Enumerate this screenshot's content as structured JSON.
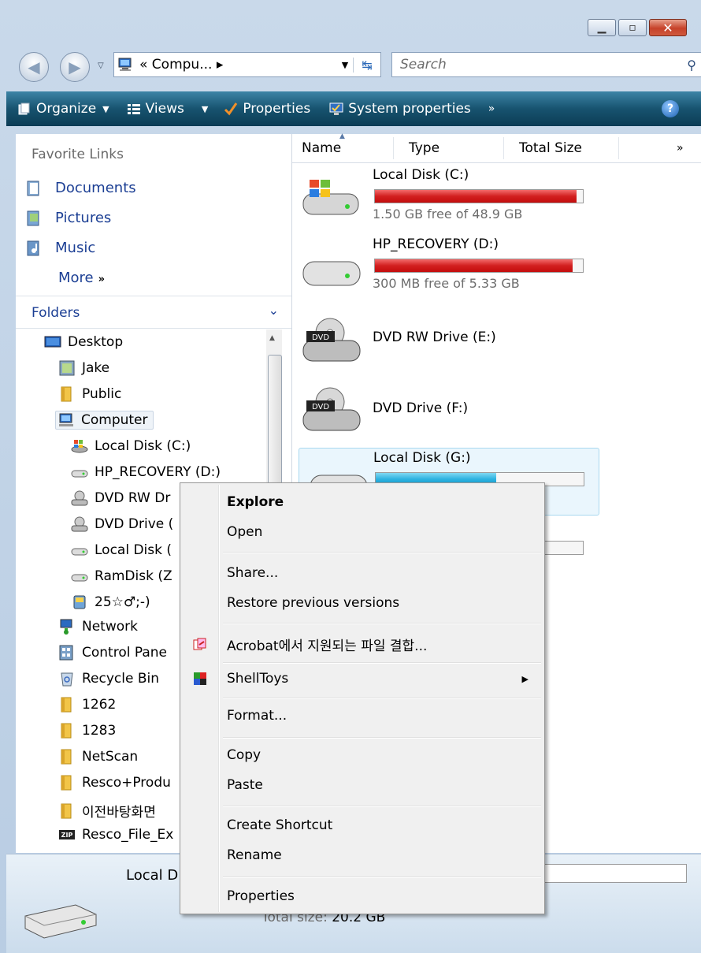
{
  "window": {
    "caption_buttons": [
      "minimize",
      "maximize",
      "close"
    ]
  },
  "address_bar": {
    "path": "« Compu... ▸",
    "search_placeholder": "Search"
  },
  "toolbar": {
    "organize": "Organize",
    "views": "Views",
    "properties": "Properties",
    "system_properties": "System properties",
    "overflow": "»"
  },
  "favorite_links": {
    "title": "Favorite Links",
    "items": [
      "Documents",
      "Pictures",
      "Music"
    ],
    "more": "More",
    "more_glyph": "»"
  },
  "folders": {
    "title": "Folders",
    "tree": [
      {
        "label": "Desktop",
        "icon": "desktop-icon"
      },
      {
        "label": "Jake",
        "icon": "user-folder-icon"
      },
      {
        "label": "Public",
        "icon": "folder-icon"
      },
      {
        "label": "Computer",
        "icon": "computer-icon",
        "selected": true
      },
      {
        "label": "Local Disk (C:)",
        "icon": "windows-drive-icon"
      },
      {
        "label": "HP_RECOVERY (D:)",
        "icon": "drive-icon"
      },
      {
        "label": "DVD RW Dr",
        "icon": "dvd-drive-icon"
      },
      {
        "label": "DVD Drive (",
        "icon": "dvd-drive-icon"
      },
      {
        "label": "Local Disk (",
        "icon": "drive-icon"
      },
      {
        "label": "RamDisk (Z",
        "icon": "drive-icon"
      },
      {
        "label": "25☆♂;-)",
        "icon": "media-icon"
      },
      {
        "label": "Network",
        "icon": "network-icon"
      },
      {
        "label": "Control Pane",
        "icon": "control-panel-icon"
      },
      {
        "label": "Recycle Bin",
        "icon": "recycle-bin-icon"
      },
      {
        "label": "1262",
        "icon": "folder-icon"
      },
      {
        "label": "1283",
        "icon": "folder-icon"
      },
      {
        "label": "NetScan",
        "icon": "folder-icon"
      },
      {
        "label": "Resco+Produ",
        "icon": "folder-icon"
      },
      {
        "label": "이전바탕화면",
        "icon": "folder-icon"
      },
      {
        "label": "Resco_File_Ex",
        "icon": "zip-icon"
      }
    ]
  },
  "columns": {
    "name": "Name",
    "type": "Type",
    "total_size": "Total Size",
    "overflow": "»"
  },
  "drives": [
    {
      "name": "Local Disk (C:)",
      "free": "1.50 GB free of 48.9 GB",
      "used_fraction": 0.97,
      "bar_color": "#d21f1f"
    },
    {
      "name": "HP_RECOVERY (D:)",
      "free": "300 MB free of 5.33 GB",
      "used_fraction": 0.95,
      "bar_color": "#d21f1f"
    },
    {
      "name": "DVD RW Drive (E:)"
    },
    {
      "name": "DVD Drive (F:)"
    },
    {
      "name": "Local Disk (G:)",
      "used_fraction": 0.58,
      "bar_color": "#2cb2e0"
    }
  ],
  "details_pane": {
    "name": "Local D",
    "total_size_label": "Total size:",
    "total_size_value": "20.2 GB"
  },
  "context_menu": {
    "items": [
      {
        "label": "Explore",
        "bold": true
      },
      {
        "label": "Open"
      },
      {
        "label": "Share..."
      },
      {
        "label": "Restore previous versions"
      },
      {
        "label": "Acrobat에서 지원되는 파일 결합...",
        "icon": "acrobat-icon"
      },
      {
        "label": "ShellToys",
        "icon": "shelltoys-icon",
        "submenu": "▶"
      },
      {
        "label": "Format..."
      },
      {
        "label": "Copy"
      },
      {
        "label": "Paste"
      },
      {
        "label": "Create Shortcut"
      },
      {
        "label": "Rename"
      },
      {
        "label": "Properties"
      }
    ]
  }
}
